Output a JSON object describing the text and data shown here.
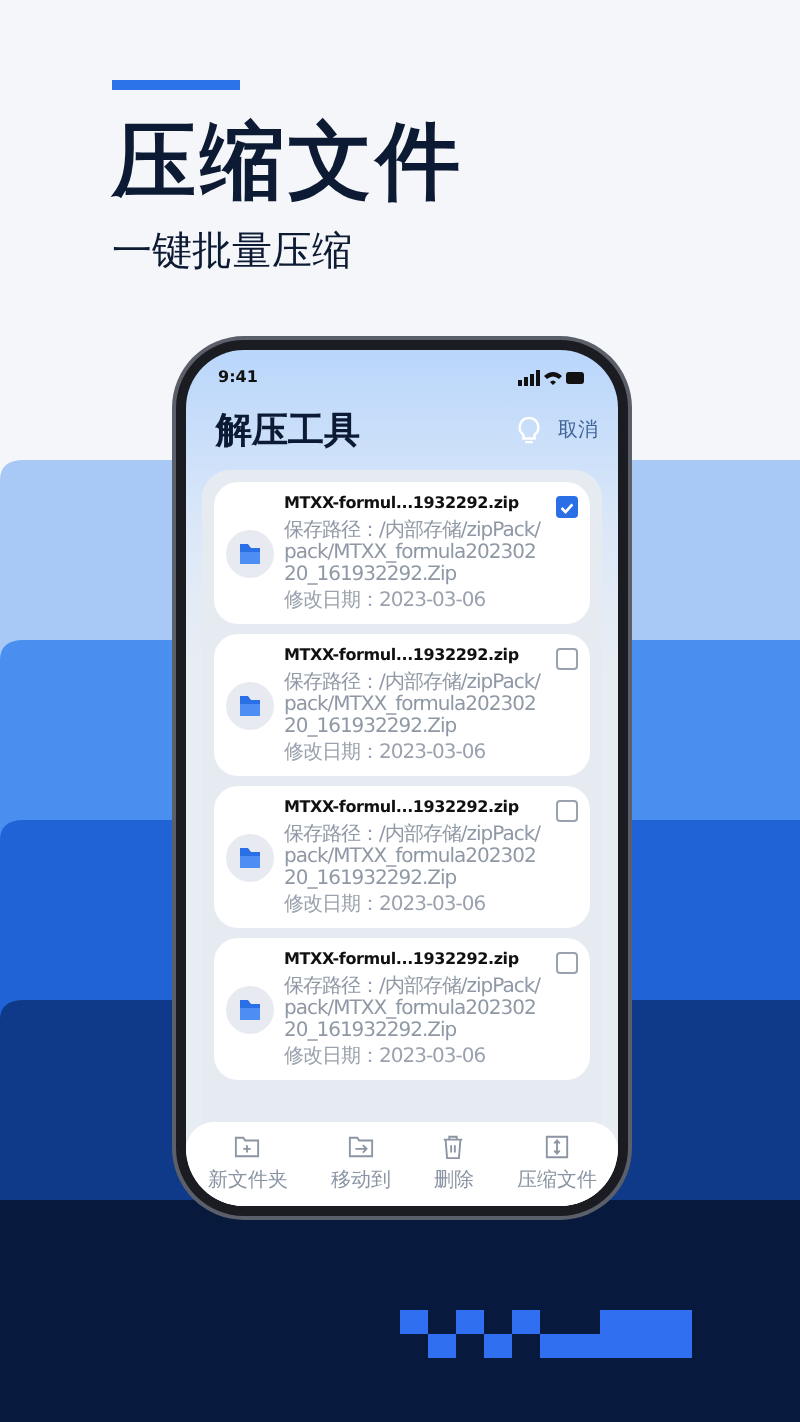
{
  "headline": "压缩文件",
  "subheadline": "一键批量压缩",
  "status_bar": {
    "time": "9:41"
  },
  "app_bar": {
    "title": "解压工具",
    "action": "取消"
  },
  "files": [
    {
      "name": "MTXX-formul...1932292.zip",
      "path": "保存路径：/内部存储/zipPack/pack/MTXX_formula20230220_161932292.Zip",
      "modified": "修改日期：2023-03-06",
      "selected": true
    },
    {
      "name": "MTXX-formul...1932292.zip",
      "path": "保存路径：/内部存储/zipPack/pack/MTXX_formula20230220_161932292.Zip",
      "modified": "修改日期：2023-03-06",
      "selected": false
    },
    {
      "name": "MTXX-formul...1932292.zip",
      "path": "保存路径：/内部存储/zipPack/pack/MTXX_formula20230220_161932292.Zip",
      "modified": "修改日期：2023-03-06",
      "selected": false
    },
    {
      "name": "MTXX-formul...1932292.zip",
      "path": "保存路径：/内部存储/zipPack/pack/MTXX_formula20230220_161932292.Zip",
      "modified": "修改日期：2023-03-06",
      "selected": false
    }
  ],
  "toolbar": [
    {
      "kind": "new-folder",
      "label": "新文件夹"
    },
    {
      "kind": "move",
      "label": "移动到"
    },
    {
      "kind": "delete",
      "label": "删除"
    },
    {
      "kind": "compress",
      "label": "压缩文件"
    }
  ]
}
